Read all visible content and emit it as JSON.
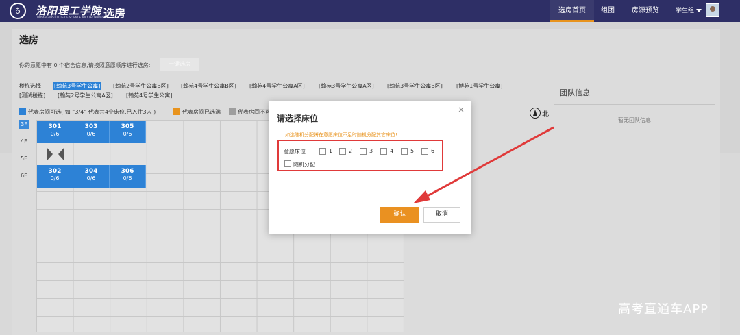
{
  "header": {
    "logo_glyph": "♁",
    "school_name": "洛阳理工学院",
    "school_name_en": "LUOYANG INSTITUTE OF SCIENCE AND TECHNOLOGY",
    "app_title": "选房",
    "nav": [
      "选房首页",
      "组团",
      "房源预览"
    ],
    "active_nav": "选房首页",
    "user_label": "学生组"
  },
  "page": {
    "title": "选房",
    "hint": "你的意愿中有 0 个宿舍信息,请按照意愿顺序进行选房:",
    "one_key_button": "一键选房",
    "building_label": "楼栋选择",
    "buildings_row1": [
      "[翰苑3号学生公寓]",
      "[翰苑2号学生公寓B区]",
      "[翰苑4号学生公寓B区]",
      "[翰苑4号学生公寓A区]",
      "[翰苑3号学生公寓A区]",
      "[翰苑3号学生公寓B区]",
      "[博苑1号学生公寓]"
    ],
    "buildings_row2": [
      "[测试楼栋]",
      "[翰苑2号学生公寓A区]",
      "[翰苑4号学生公寓]"
    ],
    "selected_building": "[翰苑3号学生公寓]",
    "legend": [
      {
        "color": "#2d82d6",
        "text": "代表房间可选( 如 “3/4” 代表共4个床位,已入住3人 )"
      },
      {
        "color": "#e8931d",
        "text": "代表房间已选满"
      },
      {
        "color": "#9e9e9e",
        "text": "代表房间不可"
      }
    ],
    "floors": [
      "3F",
      "4F",
      "5F",
      "6F"
    ],
    "active_floor": "3F",
    "rooms_top": [
      {
        "num": "301",
        "occ": "0/6"
      },
      {
        "num": "303",
        "occ": "0/6"
      },
      {
        "num": "305",
        "occ": "0/6"
      }
    ],
    "rooms_bottom": [
      {
        "num": "302",
        "occ": "0/6"
      },
      {
        "num": "304",
        "occ": "0/6"
      },
      {
        "num": "306",
        "occ": "0/6"
      }
    ],
    "compass_label": "北"
  },
  "team": {
    "title": "团队信息",
    "empty": "暂无团队信息"
  },
  "modal": {
    "title": "请选择床位",
    "close": "×",
    "warning": "如选随机分配将在意愿床位不足时随机分配其它床位!",
    "bed_label": "意愿床位:",
    "beds": [
      "1",
      "2",
      "3",
      "4",
      "5",
      "6"
    ],
    "random": "随机分配",
    "confirm": "确认",
    "cancel": "取消"
  },
  "watermark": "高考直通车APP",
  "colors": {
    "topbar": "#2e2f66",
    "accent": "#ea9121",
    "room": "#2d82d6",
    "highlight_box": "#e03a3a",
    "arrow": "#e03a3a"
  }
}
